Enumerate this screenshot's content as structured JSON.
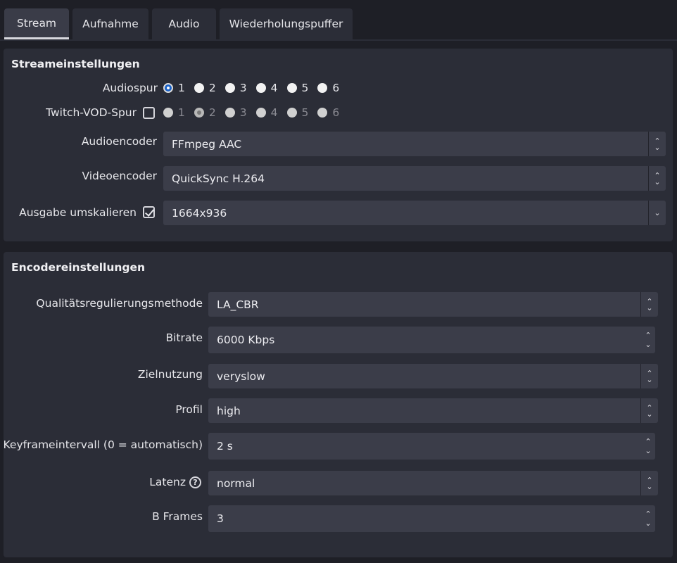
{
  "tabs": [
    "Stream",
    "Aufnahme",
    "Audio",
    "Wiederholungspuffer"
  ],
  "stream": {
    "title": "Streameinstellungen",
    "audiospur_label": "Audiospur",
    "audiospur_options": [
      "1",
      "2",
      "3",
      "4",
      "5",
      "6"
    ],
    "audiospur_selected": "1",
    "vod_label": "Twitch-VOD-Spur",
    "vod_checked": false,
    "vod_options": [
      "1",
      "2",
      "3",
      "4",
      "5",
      "6"
    ],
    "vod_selected": "2",
    "audioencoder_label": "Audioencoder",
    "audioencoder_value": "FFmpeg AAC",
    "videoencoder_label": "Videoencoder",
    "videoencoder_value": "QuickSync H.264",
    "rescale_label": "Ausgabe umskalieren",
    "rescale_checked": true,
    "rescale_value": "1664x936"
  },
  "encoder": {
    "title": "Encodereinstellungen",
    "rate_control_label": "Qualitätsregulierungsmethode",
    "rate_control_value": "LA_CBR",
    "bitrate_label": "Bitrate",
    "bitrate_value": "6000 Kbps",
    "target_label": "Zielnutzung",
    "target_value": "veryslow",
    "profile_label": "Profil",
    "profile_value": "high",
    "keyframe_label": "Keyframeintervall (0 = automatisch)",
    "keyframe_value": "2 s",
    "latency_label": "Latenz",
    "latency_value": "normal",
    "bframes_label": "B Frames",
    "bframes_value": "3"
  },
  "icons": {
    "select_arrows": "up-down-chevron-icon",
    "dropdown": "chevron-down-icon",
    "spin": "spinbox-arrows-icon",
    "help": "question-circle-icon"
  },
  "colors": {
    "background": "#1e1f26",
    "panel": "#2b2d37",
    "field": "#3b3d49",
    "accent": "#1a62c8"
  }
}
